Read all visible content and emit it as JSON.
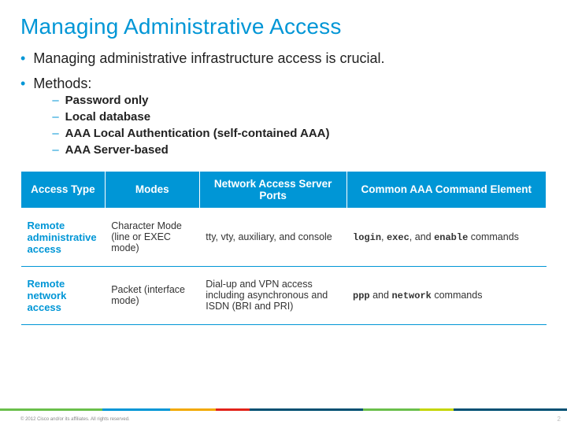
{
  "title": "Managing Administrative Access",
  "bullets": [
    "Managing administrative infrastructure access is crucial.",
    "Methods:"
  ],
  "methods": [
    "Password only",
    "Local database",
    "AAA Local Authentication (self-contained AAA)",
    "AAA Server-based"
  ],
  "table": {
    "headers": [
      "Access Type",
      "Modes",
      "Network Access Server Ports",
      "Common AAA Command Element"
    ],
    "rows": [
      {
        "type": "Remote administrative access",
        "modes": "Character Mode (line or EXEC mode)",
        "ports": "tty, vty, auxiliary, and console",
        "cmd_codes": [
          "login",
          "exec",
          "enable"
        ],
        "cmd_joiners": [
          ", ",
          ", and "
        ],
        "cmd_suffix": " commands"
      },
      {
        "type": "Remote network access",
        "modes": "Packet (interface mode)",
        "ports": "Dial-up and VPN access including asynchronous and ISDN (BRI and PRI)",
        "cmd_codes": [
          "ppp",
          "network"
        ],
        "cmd_joiners": [
          " and "
        ],
        "cmd_suffix": " commands"
      }
    ]
  },
  "footer": "© 2012 Cisco and/or its affiliates. All rights reserved.",
  "page": "2",
  "footer_colors": [
    "#6abf4b",
    "#0096d6",
    "#f2a900",
    "#e2231a",
    "#004f71",
    "#6abf4b",
    "#c4d600",
    "#005073"
  ],
  "footer_widths": [
    "18%",
    "12%",
    "8%",
    "6%",
    "20%",
    "10%",
    "6%",
    "20%"
  ]
}
